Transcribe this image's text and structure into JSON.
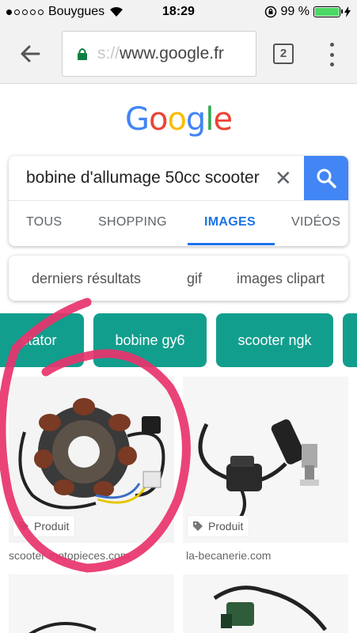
{
  "status_bar": {
    "carrier": "Bouygues",
    "time": "18:29",
    "battery_percent": "99 %"
  },
  "browser": {
    "url_faded": "s://",
    "url_domain": "www.google.fr",
    "tab_count": "2"
  },
  "logo": {
    "letters": [
      "G",
      "o",
      "o",
      "g",
      "l",
      "e"
    ]
  },
  "search": {
    "query": "bobine d'allumage 50cc scooter",
    "tabs": [
      {
        "label": "TOUS"
      },
      {
        "label": "SHOPPING"
      },
      {
        "label": "IMAGES"
      },
      {
        "label": "VIDÉOS"
      }
    ]
  },
  "suggestions": [
    "derniers résultats",
    "gif",
    "images clipart"
  ],
  "chips": [
    "stator",
    "bobine gy6",
    "scooter ngk"
  ],
  "results": [
    {
      "badge": "Produit",
      "source": "scooter-motopieces.com"
    },
    {
      "badge": "Produit",
      "source": "la-becanerie.com"
    }
  ],
  "colors": {
    "chip": "#129e8d",
    "accent_blue": "#1a73e8",
    "search_button": "#4285f4",
    "annotation": "#e8336d"
  }
}
